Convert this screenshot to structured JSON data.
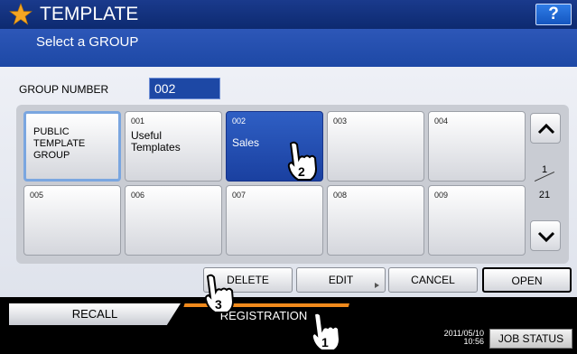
{
  "header": {
    "title": "TEMPLATE",
    "help_label": "?"
  },
  "subheader": {
    "text": "Select a GROUP"
  },
  "group_number": {
    "label": "GROUP NUMBER",
    "value": "002"
  },
  "tiles": [
    {
      "number": "",
      "name": "PUBLIC\nTEMPLATE\nGROUP"
    },
    {
      "number": "001",
      "name": "Useful\nTemplates"
    },
    {
      "number": "002",
      "name": "Sales"
    },
    {
      "number": "003",
      "name": ""
    },
    {
      "number": "004",
      "name": ""
    },
    {
      "number": "005",
      "name": ""
    },
    {
      "number": "006",
      "name": ""
    },
    {
      "number": "007",
      "name": ""
    },
    {
      "number": "008",
      "name": ""
    },
    {
      "number": "009",
      "name": ""
    }
  ],
  "pager": {
    "current": "1",
    "total": "21"
  },
  "actions": {
    "delete": "DELETE",
    "edit": "EDIT",
    "cancel": "CANCEL",
    "open": "OPEN"
  },
  "tabs": {
    "recall": "RECALL",
    "registration": "REGISTRATION"
  },
  "status": {
    "date": "2011/05/10",
    "time": "10:56",
    "job_status": "JOB STATUS"
  },
  "callouts": {
    "hand1": "1",
    "hand2": "2",
    "hand3": "3"
  },
  "colors": {
    "title_bg": "#1a3a8c",
    "selected": "#2f5fc4",
    "accent_tab": "#f08a1c"
  }
}
